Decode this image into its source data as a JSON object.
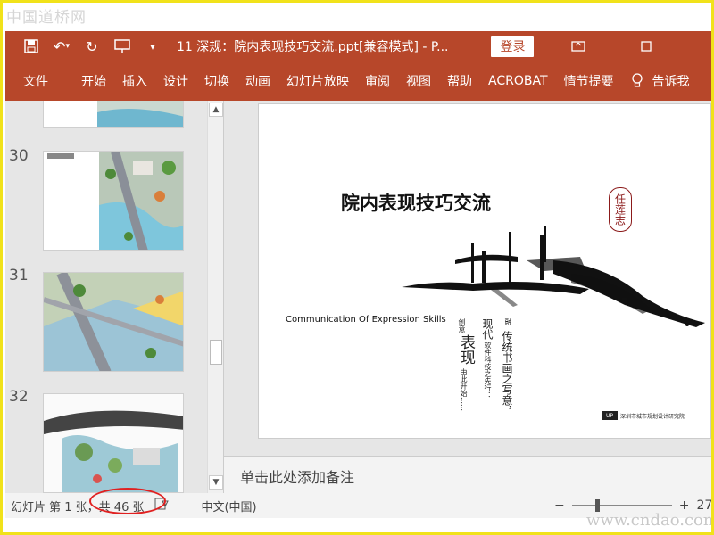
{
  "watermark_top": "中国道桥网",
  "watermark_bottom": "www.cndao.com",
  "titlebar": {
    "doc_title": "11 深规：院内表现技巧交流.ppt[兼容模式] - P...",
    "login": "登录",
    "icons": [
      "save-icon",
      "undo-icon",
      "redo-icon",
      "present-icon",
      "customize-icon"
    ]
  },
  "ribbon": {
    "tabs": [
      "文件",
      "开始",
      "插入",
      "设计",
      "切换",
      "动画",
      "幻灯片放映",
      "审阅",
      "视图",
      "帮助",
      "ACROBAT",
      "情节提要"
    ],
    "tell_me": "告诉我"
  },
  "thumbnails": [
    {
      "num": "",
      "id": "29"
    },
    {
      "num": "30",
      "id": "30"
    },
    {
      "num": "31",
      "id": "31"
    },
    {
      "num": "32",
      "id": "32"
    }
  ],
  "slide": {
    "title": "院内表现技巧交流",
    "subtitle": "Communication Of Expression Skills",
    "seal": "任莲志",
    "v1_small": "创意",
    "v1_big": "表现",
    "v1_tail": "由此开始……",
    "v2_small": "现代",
    "v2_tail": "软件科技之先行：",
    "v3_small": "融",
    "v3_big": "传统书画之写意，",
    "institute": "深圳市城市规划设计研究院"
  },
  "notes_placeholder": "单击此处添加备注",
  "status": {
    "slide_info": "幻灯片 第 1 张，共 46 张",
    "language": "中文(中国)",
    "zoom_minus": "−",
    "zoom_plus": "+",
    "zoom_value": "27"
  },
  "colors": {
    "accent": "#b7472a",
    "highlight": "#e02020"
  }
}
